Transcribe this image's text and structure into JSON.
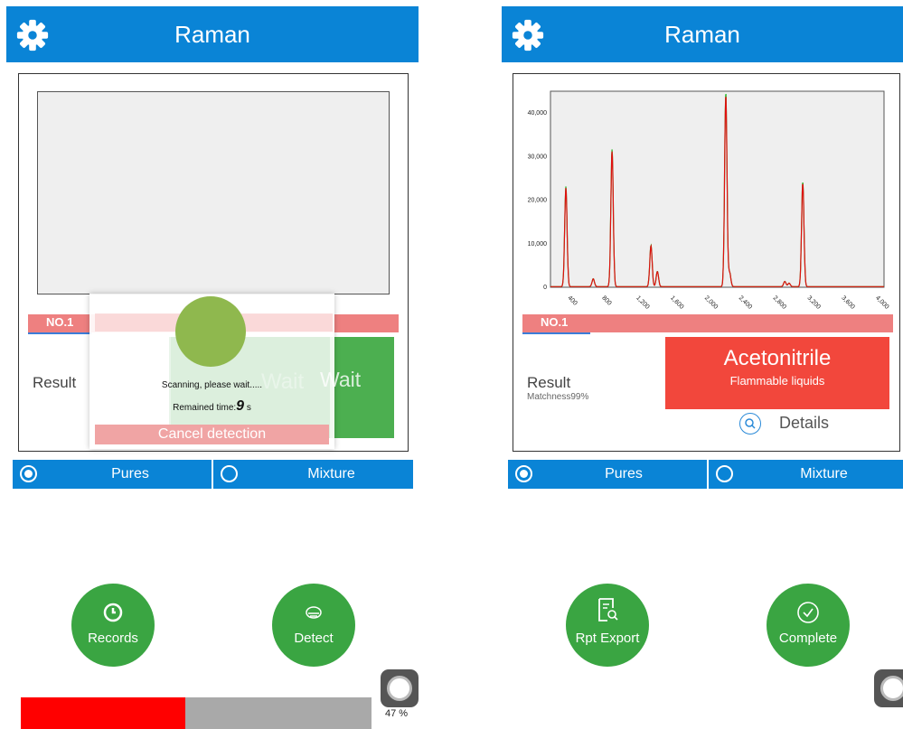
{
  "left": {
    "header": {
      "title": "Raman",
      "settings_icon": "gear-icon"
    },
    "panel": {
      "tag": "NO.1",
      "result_label": "Result",
      "status_box_text": "Wait"
    },
    "overlay": {
      "scanning_text": "Scanning, please wait.....",
      "remained_prefix": "Remained time:",
      "remained_value": "9",
      "remained_unit": "s",
      "cancel_label": "Cancel detection"
    },
    "modes": {
      "pures_label": "Pures",
      "mixture_label": "Mixture",
      "selected": "Pures"
    },
    "buttons": {
      "records_label": "Records",
      "detect_label": "Detect"
    },
    "progress": {
      "percent_text": "47 %",
      "value": 0.47,
      "fill_color": "#ff0000"
    }
  },
  "right": {
    "header": {
      "title": "Raman",
      "settings_icon": "gear-icon"
    },
    "panel": {
      "tag": "NO.1",
      "result_label": "Result",
      "matchness_text": "Matchness99%",
      "substance": "Acetonitrile",
      "hazard": "Flammable liquids",
      "details_label": "Details"
    },
    "modes": {
      "pures_label": "Pures",
      "mixture_label": "Mixture",
      "selected": "Pures"
    },
    "buttons": {
      "export_label": "Rpt Export",
      "complete_label": "Complete"
    }
  },
  "colors": {
    "primary": "#0a84d6",
    "green": "#3aa542",
    "result_red": "#f2473c",
    "tag_red": "#ee8080"
  },
  "chart_data": {
    "type": "line",
    "xlim": [
      200,
      4100
    ],
    "ylim": [
      0,
      45000
    ],
    "x_ticks": [
      "400",
      "800",
      "1,200",
      "1,600",
      "2,000",
      "2,400",
      "2,800",
      "3,200",
      "3,600",
      "4,000"
    ],
    "y_ticks": [
      "0",
      "10,000",
      "20,000",
      "30,000",
      "40,000"
    ],
    "peaks": [
      {
        "x": 380,
        "y": 23000
      },
      {
        "x": 700,
        "y": 1800
      },
      {
        "x": 920,
        "y": 31500
      },
      {
        "x": 1375,
        "y": 9500
      },
      {
        "x": 1450,
        "y": 3500
      },
      {
        "x": 2250,
        "y": 44500
      },
      {
        "x": 2295,
        "y": 3200
      },
      {
        "x": 2940,
        "y": 1200
      },
      {
        "x": 2990,
        "y": 800
      },
      {
        "x": 3150,
        "y": 24000
      }
    ],
    "series": [
      {
        "color": "#e01010"
      },
      {
        "color": "#2db82d"
      }
    ]
  }
}
